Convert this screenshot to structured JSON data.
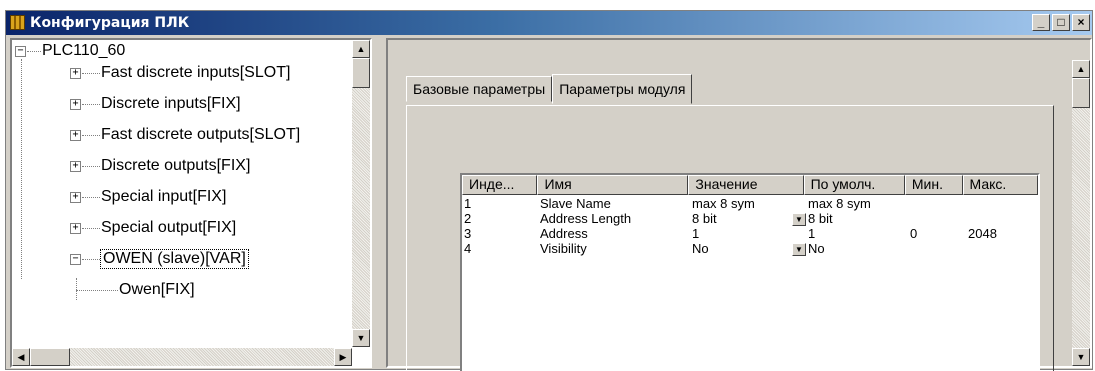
{
  "window": {
    "title": "Конфигурация ПЛК",
    "controls": {
      "minimize": "_",
      "maximize": "□",
      "close": "×"
    }
  },
  "tree": {
    "root": "PLC110_60",
    "items": [
      {
        "label": "Fast discrete inputs[SLOT]",
        "expander": "+"
      },
      {
        "label": "Discrete inputs[FIX]",
        "expander": "+"
      },
      {
        "label": "Fast discrete outputs[SLOT]",
        "expander": "+"
      },
      {
        "label": "Discrete outputs[FIX]",
        "expander": "+"
      },
      {
        "label": "Special input[FIX]",
        "expander": "+"
      },
      {
        "label": "Special output[FIX]",
        "expander": "+"
      },
      {
        "label": "OWEN (slave)[VAR]",
        "expander": "−"
      }
    ],
    "child": "Owen[FIX]"
  },
  "tabs": [
    {
      "label": "Базовые параметры",
      "active": false
    },
    {
      "label": "Параметры модуля",
      "active": true
    }
  ],
  "grid": {
    "columns": [
      "Инде...",
      "Имя",
      "Значение",
      "По умолч.",
      "Мин.",
      "Макс."
    ],
    "rows": [
      {
        "index": "1",
        "name": "Slave Name",
        "value": "max 8 sym",
        "dropdown": false,
        "default": "max 8 sym",
        "min": "",
        "max": ""
      },
      {
        "index": "2",
        "name": "Address Length",
        "value": "8 bit",
        "dropdown": true,
        "default": "8 bit",
        "min": "",
        "max": ""
      },
      {
        "index": "3",
        "name": "Address",
        "value": "1",
        "dropdown": false,
        "default": "1",
        "min": "0",
        "max": "2048"
      },
      {
        "index": "4",
        "name": "Visibility",
        "value": "No",
        "dropdown": true,
        "default": "No",
        "min": "",
        "max": ""
      }
    ]
  },
  "colors": {
    "titlebar_start": "#0a246a",
    "titlebar_end": "#a6caf0",
    "face": "#d4d0c8"
  }
}
